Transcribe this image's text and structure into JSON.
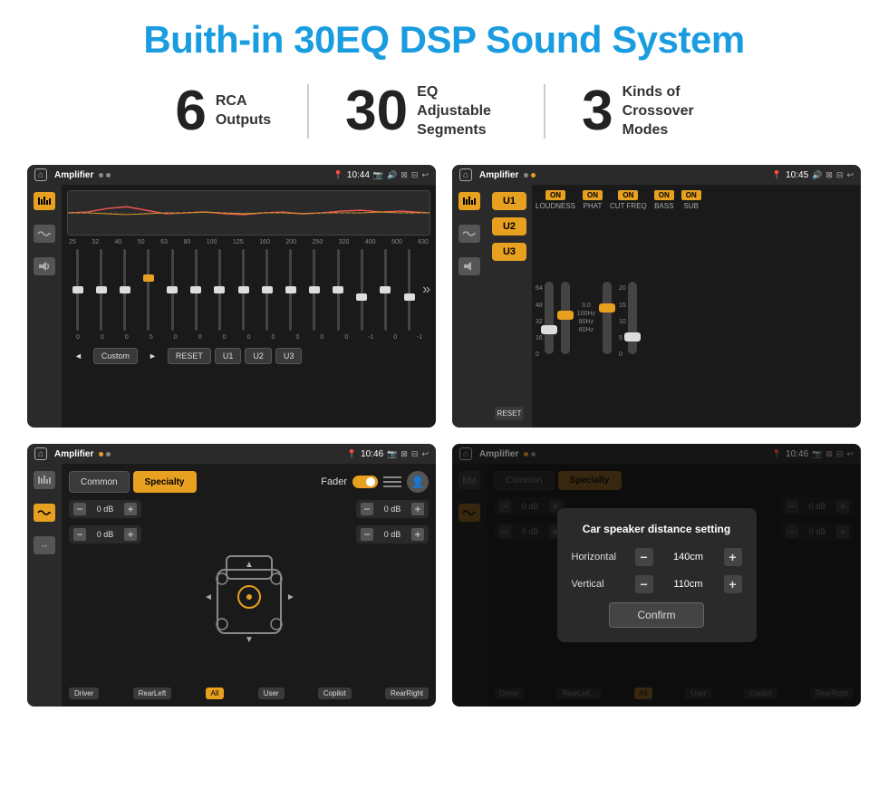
{
  "title": "Buith-in 30EQ DSP Sound System",
  "stats": [
    {
      "number": "6",
      "label": "RCA\nOutputs"
    },
    {
      "number": "30",
      "label": "EQ Adjustable\nSegments"
    },
    {
      "number": "3",
      "label": "Kinds of\nCrossover Modes"
    }
  ],
  "screens": [
    {
      "id": "screen1",
      "status_title": "Amplifier",
      "status_time": "10:44",
      "mode": "eq",
      "bottom_controls": [
        "◄",
        "Custom",
        "►",
        "RESET",
        "U1",
        "U2",
        "U3"
      ],
      "freq_labels": [
        "25",
        "32",
        "40",
        "50",
        "63",
        "80",
        "100",
        "125",
        "160",
        "200",
        "250",
        "320",
        "400",
        "500",
        "630"
      ],
      "slider_values": [
        "0",
        "0",
        "0",
        "5",
        "0",
        "0",
        "0",
        "0",
        "0",
        "0",
        "0",
        "0",
        "-1",
        "0",
        "-1"
      ]
    },
    {
      "id": "screen2",
      "status_title": "Amplifier",
      "status_time": "10:45",
      "mode": "mixer",
      "u_buttons": [
        "U1",
        "U2",
        "U3"
      ],
      "mixer_controls": [
        "LOUDNESS",
        "PHAT",
        "CUT FREQ",
        "BASS",
        "SUB"
      ],
      "reset_label": "RESET"
    },
    {
      "id": "screen3",
      "status_title": "Amplifier",
      "status_time": "10:46",
      "mode": "fader",
      "tabs": [
        "Common",
        "Specialty"
      ],
      "fader_label": "Fader",
      "db_values": [
        "0 dB",
        "0 dB",
        "0 dB",
        "0 dB"
      ],
      "location_labels": [
        "Driver",
        "RearLeft",
        "All",
        "User",
        "Copilot",
        "RearRight"
      ]
    },
    {
      "id": "screen4",
      "status_title": "Amplifier",
      "status_time": "10:46",
      "mode": "dialog",
      "tabs": [
        "Common",
        "Specialty"
      ],
      "dialog": {
        "title": "Car speaker distance setting",
        "horizontal_label": "Horizontal",
        "horizontal_value": "140cm",
        "vertical_label": "Vertical",
        "vertical_value": "110cm",
        "confirm_label": "Confirm"
      },
      "location_labels": [
        "Driver",
        "RearLeft...",
        "All",
        "User",
        "Copilot",
        "RearRight"
      ]
    }
  ]
}
